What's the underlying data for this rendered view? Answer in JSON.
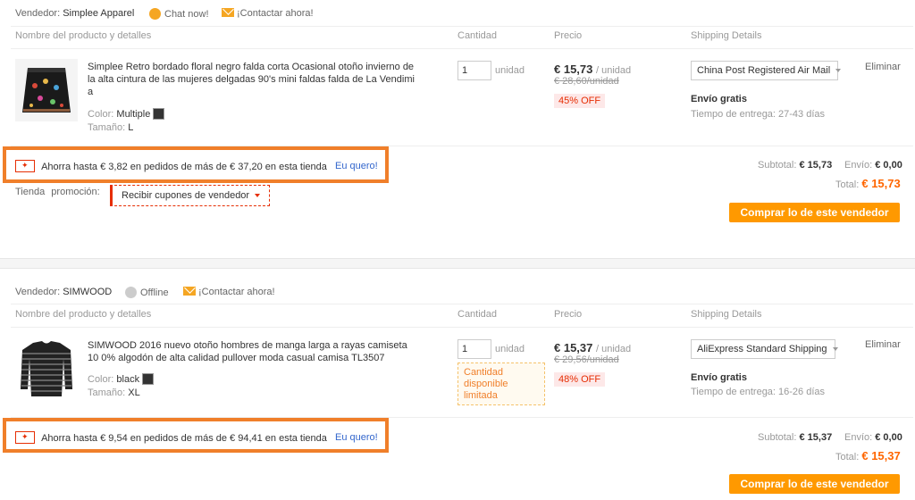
{
  "stores": [
    {
      "vendor_label": "Vendedor:",
      "vendor_name": "Simplee Apparel",
      "status_text": "Chat now!",
      "contact_text": "¡Contactar ahora!",
      "col_product": "Nombre del producto y detalles",
      "col_qty": "Cantidad",
      "col_price": "Precio",
      "col_shipping": "Shipping Details",
      "product": {
        "title": "Simplee Retro bordado floral negro falda corta Ocasional otoño invierno de la alta cintura de las mujeres delgadas 90's mini faldas falda de La Vendimi a",
        "color_label": "Color:",
        "color_value": "Multiple",
        "size_label": "Tamaño:",
        "size_value": "L",
        "qty": "1",
        "unit": "unidad",
        "price": "€ 15,73",
        "price_unit": "/ unidad",
        "old_price": "€ 28,60/unidad",
        "discount": "45% OFF",
        "shipping_method": "China Post Registered Air Mail",
        "free_shipping": "Envío gratis",
        "delivery_time": "Tiempo de entrega: 27-43 días",
        "remove": "Eliminar"
      },
      "promo_text": "Ahorra hasta € 3,82 en pedidos de más de € 37,20 en esta tienda",
      "promo_link": "Eu quero!",
      "store_promo_label_1": "Tienda",
      "store_promo_label_2": "promoción:",
      "coupon_text": "Recibir cupones de vendedor",
      "subtotal_label": "Subtotal:",
      "subtotal_value": "€ 15,73",
      "shipping_label": "Envío:",
      "shipping_value": "€ 0,00",
      "total_label": "Total:",
      "total_value": "€ 15,73",
      "buy_button": "Comprar lo de este vendedor"
    },
    {
      "vendor_label": "Vendedor:",
      "vendor_name": "SIMWOOD",
      "status_text": "Offline",
      "contact_text": "¡Contactar ahora!",
      "col_product": "Nombre del producto y detalles",
      "col_qty": "Cantidad",
      "col_price": "Precio",
      "col_shipping": "Shipping Details",
      "product": {
        "title": "SIMWOOD 2016 nuevo otoño hombres de manga larga a rayas camiseta 10 0% algodón de alta calidad pullover moda casual camisa TL3507",
        "color_label": "Color:",
        "color_value": "black",
        "size_label": "Tamaño:",
        "size_value": "XL",
        "qty": "1",
        "unit": "unidad",
        "limited_text": "Cantidad disponible limitada",
        "price": "€ 15,37",
        "price_unit": "/ unidad",
        "old_price": "€ 29,56/unidad",
        "discount": "48% OFF",
        "shipping_method": "AliExpress Standard Shipping",
        "free_shipping": "Envío gratis",
        "delivery_time": "Tiempo de entrega: 16-26 días",
        "remove": "Eliminar"
      },
      "promo_text": "Ahorra hasta € 9,54 en pedidos de más de € 94,41 en esta tienda",
      "promo_link": "Eu quero!",
      "subtotal_label": "Subtotal:",
      "subtotal_value": "€ 15,37",
      "shipping_label": "Envío:",
      "shipping_value": "€ 0,00",
      "total_label": "Total:",
      "total_value": "€ 15,37",
      "buy_button": "Comprar lo de este vendedor"
    }
  ],
  "colors": {
    "highlight_border": "#f07f2a",
    "buy_button": "#ff9900",
    "total": "#ff6600",
    "discount_text": "#e62e04",
    "link": "#3366cc"
  },
  "icons": {
    "chat": "chat-online-icon",
    "offline": "offline-icon",
    "mail": "mail-icon",
    "coupon": "coupon-icon"
  }
}
